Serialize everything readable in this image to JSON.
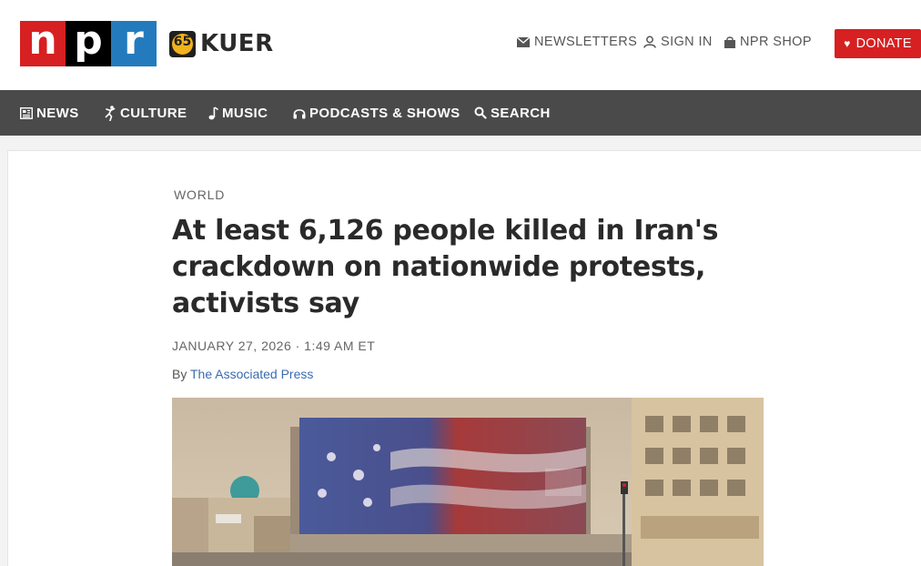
{
  "brand": {
    "npr_letters": [
      "n",
      "p",
      "r"
    ],
    "station_badge": "65",
    "station_name": "KUER"
  },
  "utility": {
    "newsletters": "NEWSLETTERS",
    "sign_in": "SIGN IN",
    "shop": "NPR SHOP",
    "donate": "DONATE"
  },
  "nav": {
    "news": "NEWS",
    "culture": "CULTURE",
    "music": "MUSIC",
    "podcasts": "PODCASTS & SHOWS",
    "search": "SEARCH"
  },
  "article": {
    "section": "WORLD",
    "headline": "At least 6,126 people killed in Iran's crackdown on nationwide protests, activists say",
    "date": "JANUARY 27, 2026 · 1:49 AM ET",
    "by_prefix": "By ",
    "author": "The Associated Press"
  },
  "colors": {
    "npr_red": "#d62021",
    "npr_black": "#000000",
    "npr_blue": "#237bbd",
    "nav_bg": "#4a4a4a",
    "link": "#3a6bb0"
  }
}
